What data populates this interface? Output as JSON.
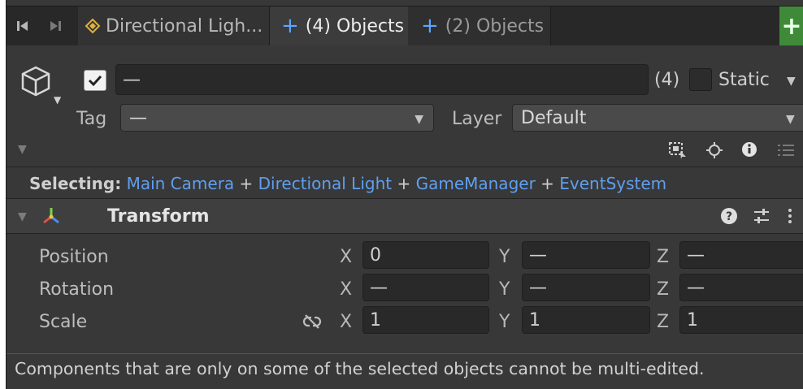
{
  "tabs": {
    "prev_icon": "step-back-icon",
    "next_icon": "step-forward-icon",
    "items": [
      {
        "label": "Directional Ligh...",
        "icon": "light-icon"
      },
      {
        "label": "(4) Objects",
        "icon": "plus-icon"
      },
      {
        "label": "(2) Objects",
        "icon": "plus-icon"
      }
    ],
    "add_label": "+"
  },
  "header": {
    "object_icon": "cube-icon",
    "active_checked": true,
    "name_value": "—",
    "count": "(4)",
    "static_label": "Static",
    "tag_label": "Tag",
    "tag_value": "—",
    "layer_label": "Layer",
    "layer_value": "Default"
  },
  "selecting": {
    "label": "Selecting:",
    "items": [
      "Main Camera",
      "Directional Light",
      "GameManager",
      "EventSystem"
    ],
    "separator": "+"
  },
  "transform": {
    "title": "Transform",
    "rows": [
      {
        "label": "Position",
        "x": "0",
        "y": "—",
        "z": "—"
      },
      {
        "label": "Rotation",
        "x": "—",
        "y": "—",
        "z": "—"
      },
      {
        "label": "Scale",
        "x": "1",
        "y": "1",
        "z": "1"
      }
    ],
    "axis_x": "X",
    "axis_y": "Y",
    "axis_z": "Z"
  },
  "footer": {
    "message": "Components that are only on some of the selected objects cannot be multi-edited."
  },
  "colors": {
    "accent_link": "#5f9ff0",
    "add_button": "#3f8a39",
    "background": "#383838"
  }
}
